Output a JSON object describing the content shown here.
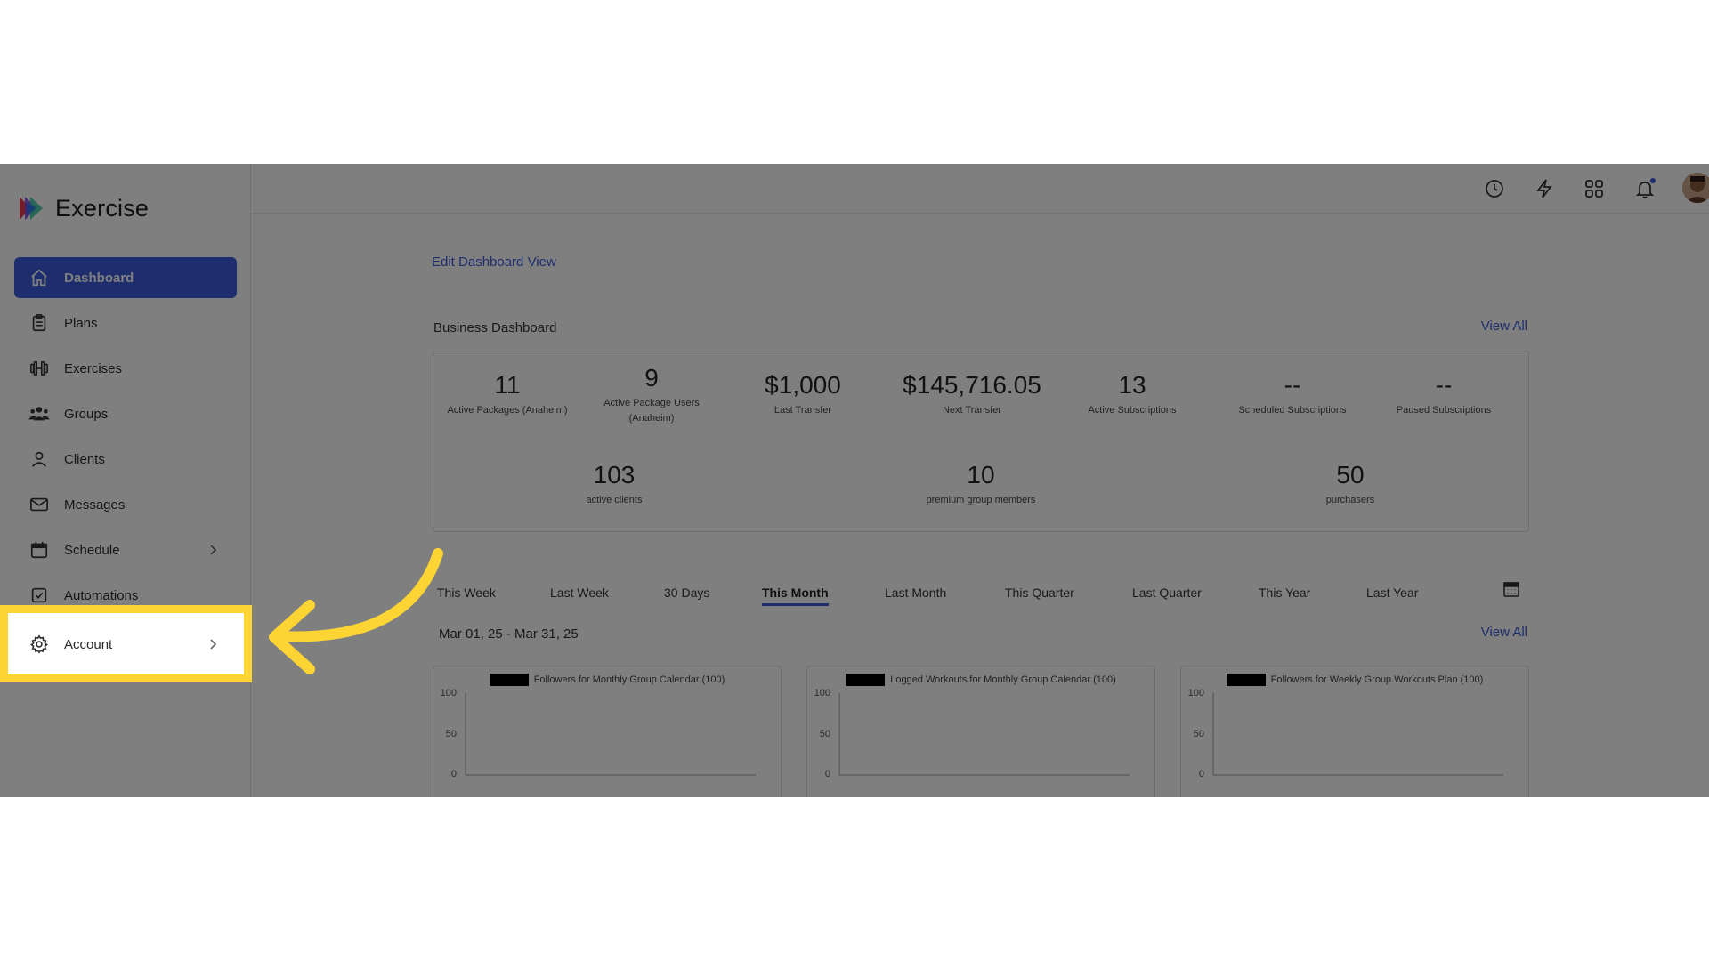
{
  "app": {
    "brand": "Exercise",
    "accent": "#3b5bdb",
    "highlight_color": "#fcd535"
  },
  "sidebar": {
    "items": [
      {
        "label": "Dashboard",
        "icon": "home-icon",
        "active": true
      },
      {
        "label": "Plans",
        "icon": "clipboard-icon"
      },
      {
        "label": "Exercises",
        "icon": "dumbbell-icon"
      },
      {
        "label": "Groups",
        "icon": "users-icon"
      },
      {
        "label": "Clients",
        "icon": "user-icon"
      },
      {
        "label": "Messages",
        "icon": "mail-icon"
      },
      {
        "label": "Schedule",
        "icon": "calendar-icon",
        "has_submenu": true
      },
      {
        "label": "Automations",
        "icon": "checkbox-icon"
      },
      {
        "label": "Account",
        "icon": "gear-icon",
        "has_submenu": true,
        "highlighted": true
      }
    ]
  },
  "topbar": {
    "icons": [
      "clock-icon",
      "bolt-icon",
      "apps-grid-icon",
      "bell-icon",
      "avatar"
    ]
  },
  "main": {
    "edit_link": "Edit Dashboard View",
    "business_dashboard": {
      "title": "Business Dashboard",
      "view_all": "View All",
      "stats_row1": [
        {
          "value": "11",
          "label": "Active Packages (Anaheim)"
        },
        {
          "value": "9",
          "label": "Active Package Users (Anaheim)"
        },
        {
          "value": "$1,000",
          "label": "Last Transfer"
        },
        {
          "value": "$145,716.05",
          "label": "Next Transfer"
        },
        {
          "value": "13",
          "label": "Active Subscriptions"
        },
        {
          "value": "--",
          "label": "Scheduled Subscriptions"
        },
        {
          "value": "--",
          "label": "Paused Subscriptions"
        }
      ],
      "stats_row2": [
        {
          "value": "103",
          "label": "active clients"
        },
        {
          "value": "10",
          "label": "premium group members"
        },
        {
          "value": "50",
          "label": "purchasers"
        }
      ]
    },
    "period_tabs": [
      "This Week",
      "Last Week",
      "30 Days",
      "This Month",
      "Last Month",
      "This Quarter",
      "Last Quarter",
      "This Year",
      "Last Year"
    ],
    "active_period": "This Month",
    "date_range": "Mar 01, 25 - Mar 31, 25",
    "charts_view_all": "View All"
  },
  "chart_data": [
    {
      "type": "line",
      "series": [
        {
          "name": "Followers for Monthly Group Calendar (100)",
          "values": []
        }
      ],
      "yticks": [
        "100",
        "50",
        "0"
      ],
      "ylim": [
        0,
        100
      ]
    },
    {
      "type": "line",
      "series": [
        {
          "name": "Logged Workouts for Monthly Group Calendar (100)",
          "values": []
        }
      ],
      "yticks": [
        "100",
        "50",
        "0"
      ],
      "ylim": [
        0,
        100
      ]
    },
    {
      "type": "line",
      "series": [
        {
          "name": "Followers for Weekly Group Workouts Plan (100)",
          "values": []
        }
      ],
      "yticks": [
        "100",
        "50",
        "0"
      ],
      "ylim": [
        0,
        100
      ]
    }
  ]
}
